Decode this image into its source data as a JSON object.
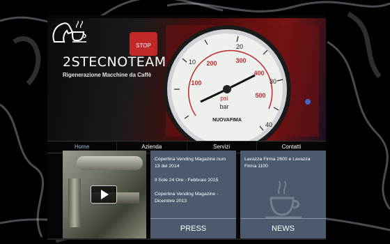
{
  "brand": {
    "name": "2STECNOTEAM",
    "tagline": "Rigenerazione Macchine da Caffè"
  },
  "gauge": {
    "outer_scale": [
      "10",
      "20",
      "30",
      "40"
    ],
    "inner_scale": [
      "100",
      "200",
      "300",
      "400",
      "500"
    ],
    "units": [
      "psi",
      "bar"
    ],
    "maker": "NUOVAFIMA",
    "side_label": "STOP"
  },
  "nav": {
    "items": [
      {
        "label": "Home",
        "active": true
      },
      {
        "label": "Azienda",
        "active": false
      },
      {
        "label": "Servizi",
        "active": false
      },
      {
        "label": "Contatti",
        "active": false
      }
    ]
  },
  "press": {
    "items": [
      "Copertina Vending Magazine num 13 del 2014",
      "Il Sole 24 Ore - Febbraio 2015",
      "Copertina Vending Magazine - Dicembre 2013"
    ],
    "footer": "PRESS"
  },
  "news": {
    "items": [
      "Lavazza Firma 2600 e Lavazza Firma 1100"
    ],
    "footer": "NEWS"
  },
  "colors": {
    "panel_bg": "#4d5a6e",
    "nav_active": "#9eb6d6",
    "gauge_red": "#c0282a"
  },
  "icons": {
    "logo": "horse-head-coffee-cup-icon",
    "play": "play-icon",
    "watermark": "coffee-cup-icon"
  }
}
